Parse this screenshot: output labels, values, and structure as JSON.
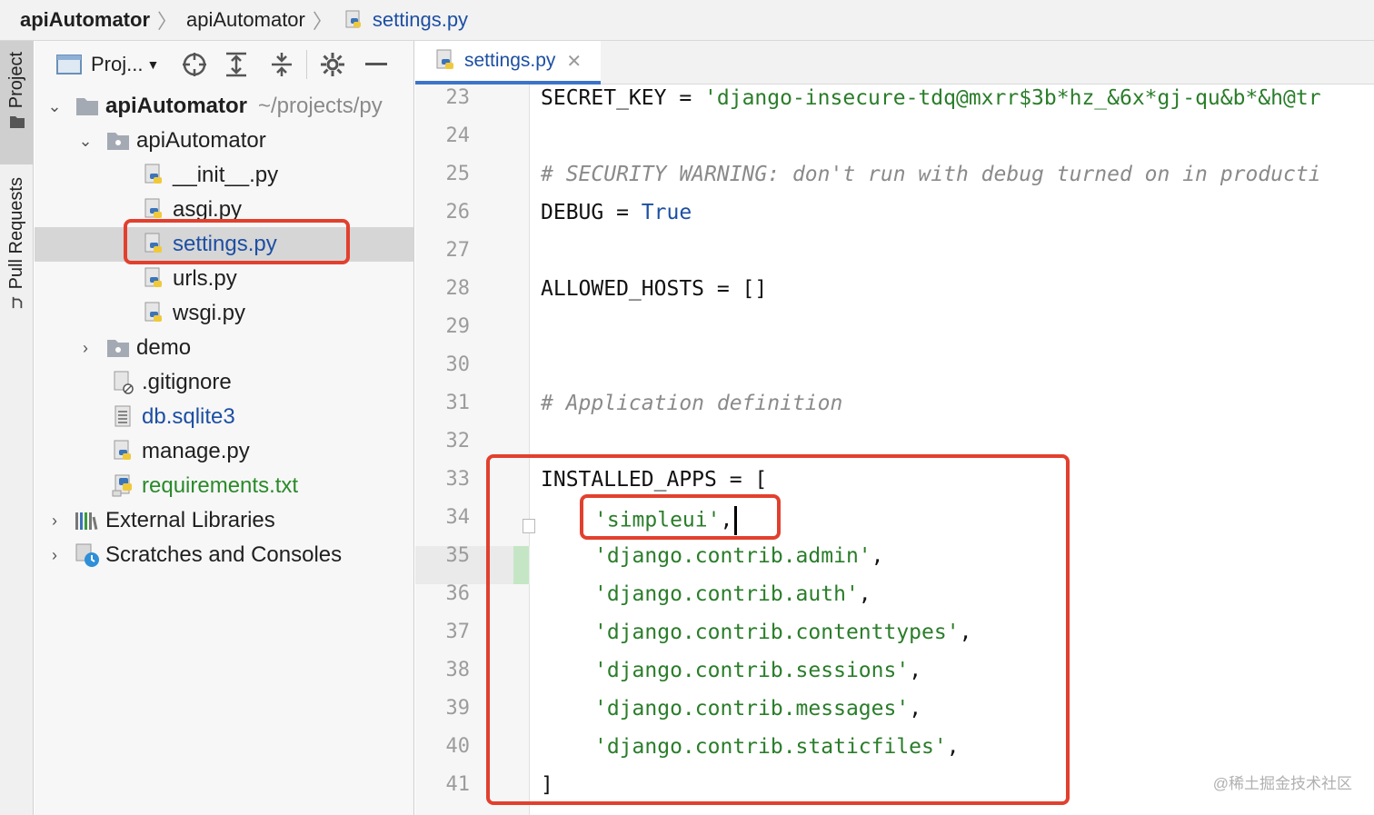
{
  "breadcrumb": {
    "root": "apiAutomator",
    "folder": "apiAutomator",
    "file": "settings.py"
  },
  "toolstrip": {
    "project_tab": "Project",
    "pull_requests_tab": "Pull Requests"
  },
  "panel": {
    "view_selector": "Proj...",
    "tree": {
      "root": {
        "label": "apiAutomator",
        "path_hint": "~/projects/py"
      },
      "pkg": "apiAutomator",
      "init": "__init__.py",
      "asgi": "asgi.py",
      "settings": "settings.py",
      "urls": "urls.py",
      "wsgi": "wsgi.py",
      "demo": "demo",
      "gitignore": ".gitignore",
      "db": "db.sqlite3",
      "manage": "manage.py",
      "requirements": "requirements.txt",
      "external": "External Libraries",
      "scratches": "Scratches and Consoles"
    }
  },
  "editor": {
    "tab_label": "settings.py",
    "line_numbers": [
      "23",
      "24",
      "25",
      "26",
      "27",
      "28",
      "29",
      "30",
      "31",
      "32",
      "33",
      "34",
      "35",
      "36",
      "37",
      "38",
      "39",
      "40",
      "41"
    ],
    "code": {
      "l23_name": "SECRET_KEY",
      "l23_op": " = ",
      "l23_value": "'django-insecure-tdq@mxrr$3b*hz_&6x*gj-qu&b*&h@tr",
      "l25_comment": "# SECURITY WARNING: don't run with debug turned on in producti",
      "l26_name": "DEBUG",
      "l26_op": " = ",
      "l26_value": "True",
      "l28_text": "ALLOWED_HOSTS = []",
      "l31_comment": "# Application definition",
      "l33_text": "INSTALLED_APPS = [",
      "l34_value": "'simpleui'",
      "l35_value": "'django.contrib.admin'",
      "l36_value": "'django.contrib.auth'",
      "l37_value": "'django.contrib.contenttypes'",
      "l38_value": "'django.contrib.sessions'",
      "l39_value": "'django.contrib.messages'",
      "l40_value": "'django.contrib.staticfiles'",
      "l41_text": "]",
      "comma": ","
    }
  },
  "watermark": "@稀土掘金技术社区",
  "colors": {
    "highlight_box": "#e2402e",
    "string": "#2a7d2a",
    "keyword": "#1d4fa3"
  }
}
